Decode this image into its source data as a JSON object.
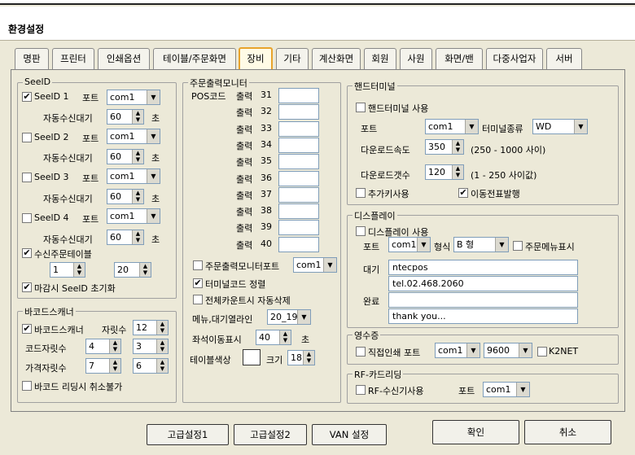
{
  "window": {
    "title": "환경설정"
  },
  "tabs": [
    "명판",
    "프린터",
    "인쇄옵션",
    "테이블/주문화면",
    "장비",
    "기타",
    "계산화면",
    "회원",
    "사원",
    "화면/밴",
    "다중사업자",
    "서버"
  ],
  "seelD": {
    "group_label": "SeelD",
    "port_label": "포트",
    "wait_label": "자동수신대기",
    "unit": "초",
    "items": [
      {
        "label": "SeelD 1",
        "checked": true,
        "check": "✔",
        "port": "com1",
        "wait": "60"
      },
      {
        "label": "SeelD 2",
        "checked": false,
        "check": "",
        "port": "com1",
        "wait": "60"
      },
      {
        "label": "SeelD 3",
        "checked": false,
        "check": "",
        "port": "com1",
        "wait": "60"
      },
      {
        "label": "SeelD 4",
        "checked": false,
        "check": "",
        "port": "com1",
        "wait": "60"
      }
    ],
    "recv_table": {
      "label": "수신주문테이블",
      "check": "✔",
      "from": "1",
      "to": "20"
    },
    "close_init": {
      "label": "마감시 SeelD 초기화",
      "check": "✔"
    }
  },
  "barcode": {
    "group_label": "바코드스캐너",
    "scanner": {
      "label": "바코드스캐너",
      "check": "✔"
    },
    "digits_label": "자릿수",
    "digits": "12",
    "code_label": "코드자릿수",
    "code_a": "4",
    "code_b": "3",
    "price_label": "가격자릿수",
    "price_a": "7",
    "price_b": "6",
    "cancel": {
      "label": "바코드 리딩시 취소불가",
      "check": ""
    }
  },
  "monitor": {
    "group_label": "주문출력모니터",
    "pos_label": "POS코드",
    "outputs": [
      {
        "label": "출력",
        "num": "31",
        "value": ""
      },
      {
        "label": "출력",
        "num": "32",
        "value": ""
      },
      {
        "label": "출력",
        "num": "33",
        "value": ""
      },
      {
        "label": "출력",
        "num": "34",
        "value": ""
      },
      {
        "label": "출력",
        "num": "35",
        "value": ""
      },
      {
        "label": "출력",
        "num": "36",
        "value": ""
      },
      {
        "label": "출력",
        "num": "37",
        "value": ""
      },
      {
        "label": "출력",
        "num": "38",
        "value": ""
      },
      {
        "label": "출력",
        "num": "39",
        "value": ""
      },
      {
        "label": "출력",
        "num": "40",
        "value": ""
      }
    ],
    "monitor_port": {
      "label": "주문출력모니터포트",
      "check": "",
      "port": "com1"
    },
    "terminal_sort": {
      "label": "터미널코드 정렬",
      "check": "✔"
    },
    "auto_delete": {
      "label": "전체카운트시 자동삭제",
      "check": ""
    },
    "menu_wait_label": "메뉴,대기열라인",
    "menu_wait": "20_19",
    "seat_label": "좌석이동표시",
    "seat_value": "40",
    "seat_unit": "초",
    "table_color_label": "테이블색상",
    "size_label": "크기",
    "size_value": "18"
  },
  "handterminal": {
    "group_label": "핸드터미널",
    "use": {
      "label": "핸드터미널 사용",
      "check": ""
    },
    "port_label": "포트",
    "port": "com1",
    "type_label": "터미널종류",
    "type": "WD",
    "speed_label": "다운로드속도",
    "speed": "350",
    "speed_range": "(250 - 1000 사이)",
    "count_label": "다운로드갯수",
    "count": "120",
    "count_range": "(1 - 250 사이값)",
    "addkey": {
      "label": "추가키사용",
      "check": ""
    },
    "move_slip": {
      "label": "이동전표발행",
      "check": "✔"
    }
  },
  "display": {
    "group_label": "디스플레이",
    "use": {
      "label": "디스플레이 사용",
      "check": ""
    },
    "port_label": "포트",
    "port": "com1",
    "format_label": "형식",
    "format": "B 형",
    "order_menu": {
      "label": "주문메뉴표시",
      "check": ""
    },
    "wait_label": "대기",
    "wait_line1": "ntecpos",
    "wait_line2": "tel.02.468.2060",
    "done_label": "완료",
    "done_line1": "",
    "done_line2": "thank you..."
  },
  "receipt": {
    "group_label": "영수증",
    "direct": {
      "label": "직접인쇄 포트",
      "check": ""
    },
    "port": "com1",
    "baud": "9600",
    "k2net": {
      "label": "K2NET",
      "check": ""
    }
  },
  "rf": {
    "group_label": "RF-카드리딩",
    "use": {
      "label": "RF-수신기사용",
      "check": ""
    },
    "port_label": "포트",
    "port": "com1"
  },
  "buttons": {
    "adv1": "고급설정1",
    "adv2": "고급설정2",
    "van": "VAN 설정",
    "ok": "확인",
    "cancel": "취소"
  }
}
